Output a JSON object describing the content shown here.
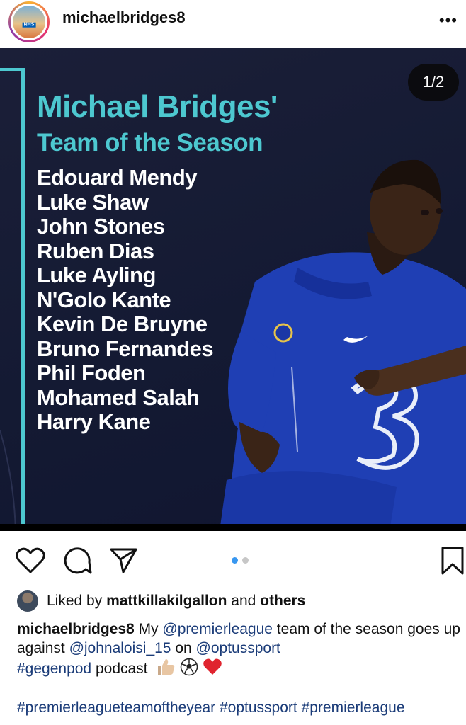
{
  "post": {
    "username": "michaelbridges8",
    "avatar_badge": "NHS",
    "more_icon": "more-horizontal-icon"
  },
  "image": {
    "page_counter": "1/2",
    "title_line1": "Michael Bridges'",
    "title_line2": "Team of the Season",
    "players": [
      "Edouard Mendy",
      "Luke Shaw",
      "John Stones",
      "Ruben Dias",
      "Luke Ayling",
      "N'Golo Kante",
      "Kevin De Bruyne",
      "Bruno Fernandes",
      "Phil Foden",
      "Mohamed Salah",
      "Harry Kane"
    ],
    "accent_color": "#4dc8d0",
    "kit_color": "#1f3fb4"
  },
  "actions": {
    "like_icon": "heart-icon",
    "comment_icon": "comment-icon",
    "share_icon": "send-icon",
    "save_icon": "bookmark-icon",
    "carousel_count": 2,
    "carousel_active": 1
  },
  "likes": {
    "prefix": "Liked by ",
    "user": "mattkillakilgallon",
    "middle": " and ",
    "others": "others"
  },
  "caption": {
    "username": "michaelbridges8",
    "t1": " My ",
    "mention1": "@premierleague",
    "t2": " team of the season goes up against ",
    "mention2": "@johnaloisi_15",
    "t3": " on ",
    "mention3": "@optussport",
    "hashtag1": "#gegenpod",
    "t4": " podcast ",
    "emojis": [
      "thumbs-up-icon",
      "soccer-ball-icon",
      "red-heart-icon"
    ],
    "hashtags": "#premierleagueteamoftheyear #optussport #premierleague"
  }
}
